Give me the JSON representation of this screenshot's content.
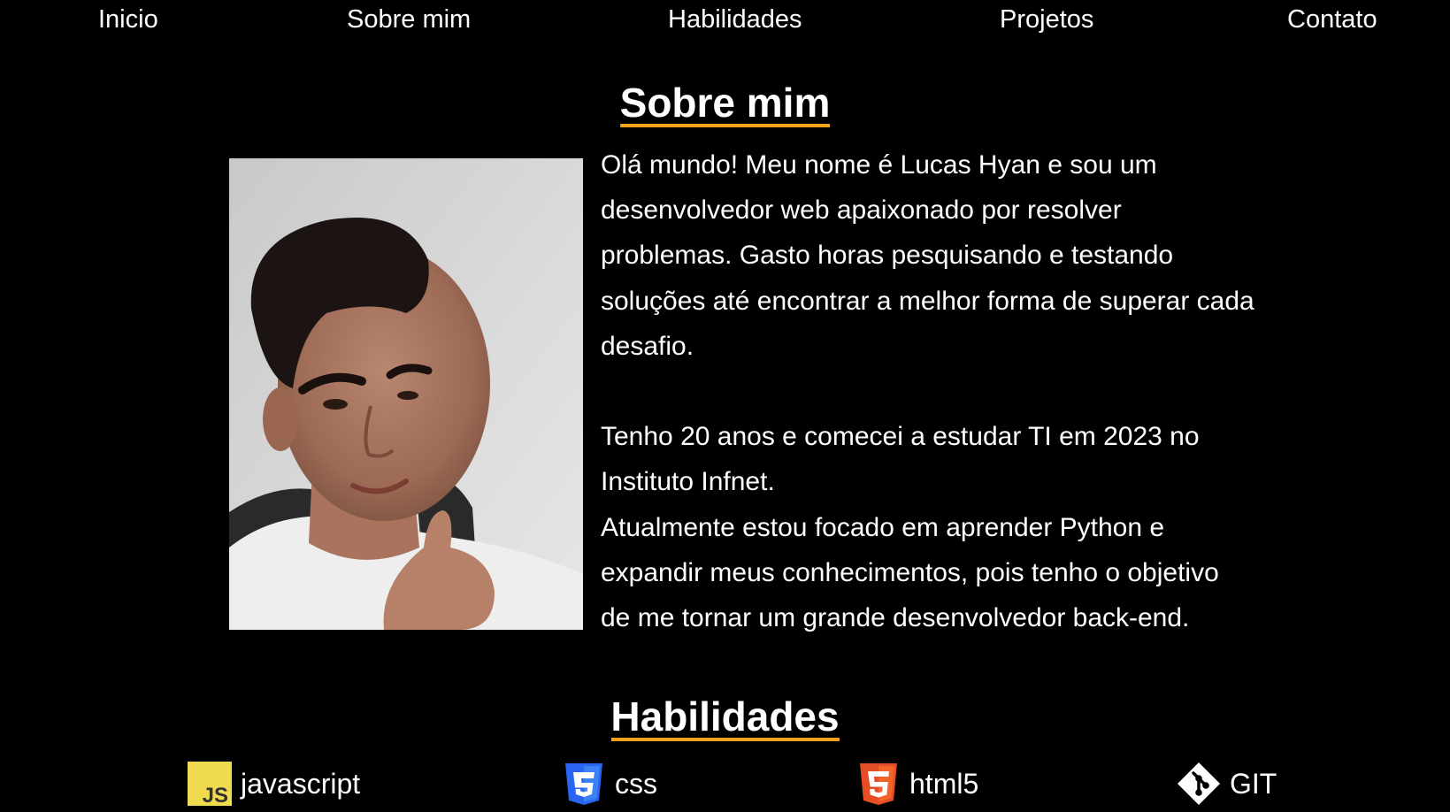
{
  "nav": {
    "items": [
      "Inicio",
      "Sobre mim",
      "Habilidades",
      "Projetos",
      "Contato"
    ]
  },
  "about": {
    "title": "Sobre mim",
    "paragraphs": [
      "Olá mundo! Meu nome é Lucas Hyan e sou um desenvolvedor web apaixonado por resolver problemas. Gasto horas pesquisando e testando soluções até encontrar a melhor forma de superar cada desafio.",
      "Tenho 20 anos e comecei a estudar TI em 2023 no Instituto Infnet.",
      "Atualmente estou focado em aprender Python e expandir meus conhecimentos, pois tenho o objetivo de me tornar um grande desenvolvedor back-end."
    ]
  },
  "skills": {
    "title": "Habilidades",
    "items": [
      {
        "label": "javascript",
        "icon": "javascript-icon",
        "color": "#f0db4f",
        "badge": "JS"
      },
      {
        "label": "css",
        "icon": "css3-icon",
        "color": "#2965f1",
        "badge": "3"
      },
      {
        "label": "html5",
        "icon": "html5-icon",
        "color": "#e44d26",
        "badge": "5"
      },
      {
        "label": "GIT",
        "icon": "git-icon",
        "color": "#ffffff"
      }
    ]
  },
  "colors": {
    "background": "#000000",
    "text": "#ffffff",
    "accent": "#f7a21b"
  }
}
